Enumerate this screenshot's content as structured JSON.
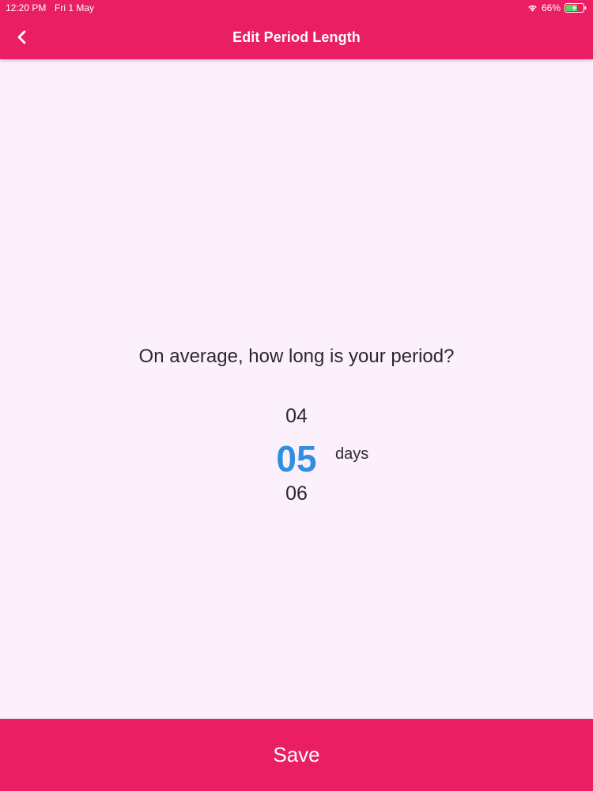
{
  "status_bar": {
    "time": "12:20 PM",
    "date": "Fri 1 May",
    "battery": "66%",
    "wifi_icon": "wifi-icon",
    "battery_icon": "battery-charging-icon"
  },
  "nav": {
    "title": "Edit Period Length",
    "back_icon": "chevron-left-icon"
  },
  "question": "On average, how long is your period?",
  "picker": {
    "previous": "04",
    "selected": "05",
    "next": "06",
    "unit": "days"
  },
  "save_label": "Save",
  "colors": {
    "accent": "#e91e63",
    "background": "#fcf0fc",
    "selected_value": "#2f8fe0",
    "text": "#2b2730"
  }
}
